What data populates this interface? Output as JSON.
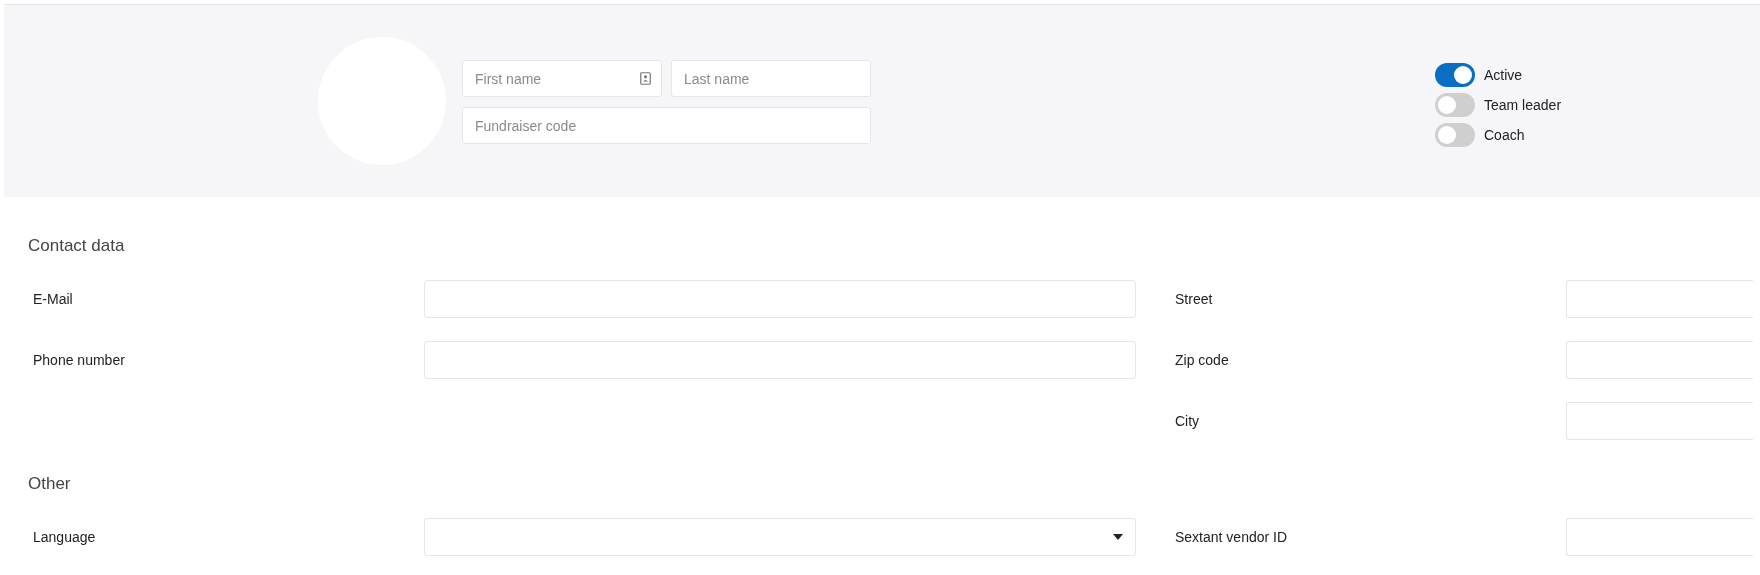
{
  "header": {
    "name_fields": [
      {
        "placeholder": "First name",
        "kind": "text_with_icon"
      },
      {
        "placeholder": "Last name",
        "kind": "text"
      }
    ],
    "code_field": {
      "placeholder": "Fundraiser code"
    },
    "toggles": [
      {
        "label": "Active",
        "on": true
      },
      {
        "label": "Team leader",
        "on": false
      },
      {
        "label": "Coach",
        "on": false
      }
    ]
  },
  "sections": [
    {
      "title": "Contact data",
      "left": [
        {
          "label": "E-Mail",
          "kind": "text"
        },
        {
          "label": "Phone number",
          "kind": "text"
        }
      ],
      "right": [
        {
          "label": "Street",
          "kind": "text"
        },
        {
          "label": "Zip code",
          "kind": "text"
        },
        {
          "label": "City",
          "kind": "text"
        }
      ]
    },
    {
      "title": "Other",
      "left": [
        {
          "label": "Language",
          "kind": "select"
        }
      ],
      "right": [
        {
          "label": "Sextant vendor ID",
          "kind": "text"
        }
      ]
    }
  ]
}
